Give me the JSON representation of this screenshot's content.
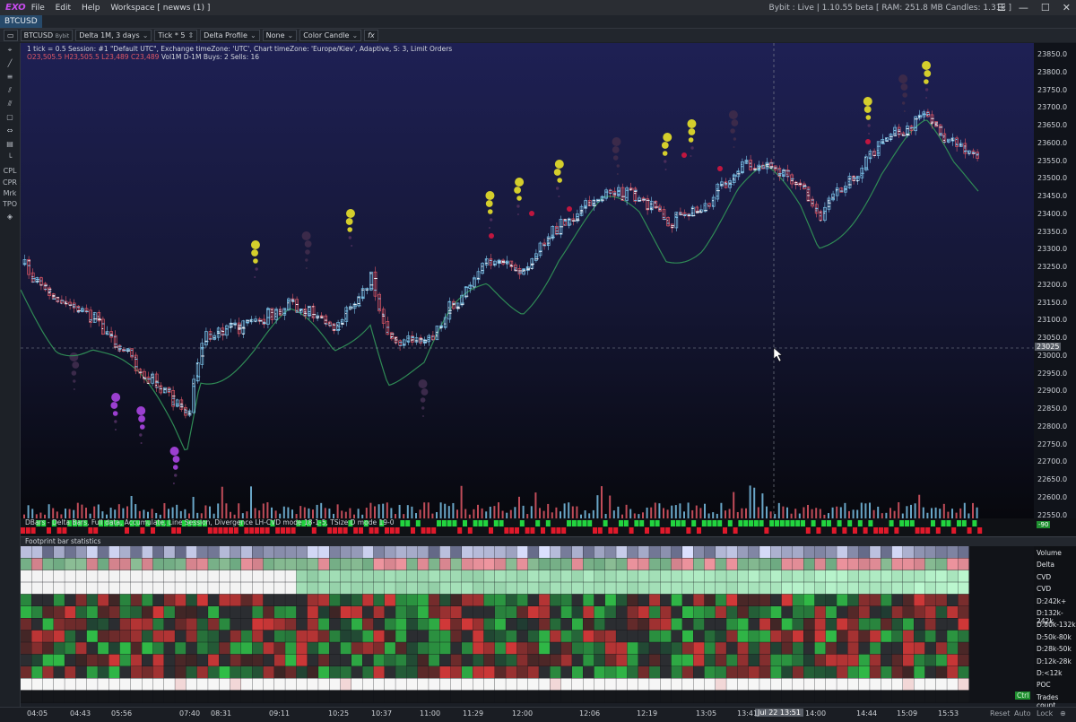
{
  "app": {
    "logo": "EXO",
    "menu": [
      "File",
      "Edit",
      "Help",
      "Workspace [ newws (1) ]"
    ],
    "status": "Bybit : Live | 1.10.55 beta   [ RAM: 251.8 MB Candles: 1.31k ]"
  },
  "tab": {
    "label": "BTCUSD"
  },
  "toolbar": {
    "symbol": "BTCUSD",
    "exchange": "Bybit",
    "timeframe": "Delta 1M, 3 days",
    "tick": "Tick * 5",
    "profile": "Delta Profile",
    "none": "None",
    "candle": "Color Candle",
    "fx": "fx"
  },
  "left_tools": [
    "cursor",
    "line",
    "hlines",
    "channel",
    "fib",
    "rect",
    "measure",
    "text",
    "anchor",
    "CPL",
    "CPR",
    "Mrk",
    "TPO",
    "layers"
  ],
  "info": {
    "line1": "1 tick = 0.5   Session: #1 \"Default UTC\",  Exchange timeZone: 'UTC',  Chart timeZone: 'Europe/Kiev',  Adaptive, S: 3,   Limit Orders",
    "ohlc_o": "O23,505.5",
    "ohlc_h": "H23,505.5",
    "ohlc_l": "L23,489",
    "ohlc_c": "C23,489",
    "vol": "Vol1M",
    "d": "D-1M",
    "buys": "Buys: 2 Sells: 16"
  },
  "price_axis": {
    "ticks": [
      "23850.0",
      "23800.0",
      "23750.0",
      "23700.0",
      "23650.0",
      "23600.0",
      "23550.0",
      "23500.0",
      "23450.0",
      "23400.0",
      "23350.0",
      "23300.0",
      "23250.0",
      "23200.0",
      "23150.0",
      "23100.0",
      "23050.0",
      "23000.0",
      "22950.0",
      "22900.0",
      "22850.0",
      "22800.0",
      "22750.0",
      "22700.0",
      "22650.0",
      "22600.0",
      "22550.0"
    ],
    "current": "23025",
    "dbars_badge": "-90"
  },
  "dbars_label": "DBars - Delta Bars, Full data, Accumulate, Line Session, Divergence LH-CVD mode 18-1-5, TSize D mode 19-0",
  "footprint_label": "Footprint bar statistics",
  "row_labels": [
    "Volume",
    "Delta",
    "CVD",
    "CVD",
    "D:242k+",
    "D:132k-242k",
    "D:80k-132k",
    "D:50k-80k",
    "D:28k-50k",
    "D:12k-28k",
    "D:<12k",
    "POC",
    "Trades count"
  ],
  "ctrl": "Ctrl",
  "time_axis": {
    "labels": [
      "04:05",
      "04:43",
      "05:56",
      "07:40",
      "08:31",
      "09:11",
      "10:25",
      "10:37",
      "11:00",
      "11:29",
      "12:00",
      "12:06",
      "12:19",
      "13:05",
      "13:41",
      "14:00",
      "14:44",
      "15:09",
      "15:53"
    ],
    "cursor": "Jul 22 13:51",
    "controls": [
      "Reset",
      "Auto",
      "Lock"
    ]
  },
  "colors": {
    "bg_top": "#1d1f52",
    "bg_bottom": "#07080d",
    "up": "#7ac2e8",
    "down": "#e05866",
    "line": "#2f8a55",
    "yellow": "#d4ce2c",
    "purple": "#9b3fd0",
    "crimson": "#c0163f"
  }
}
